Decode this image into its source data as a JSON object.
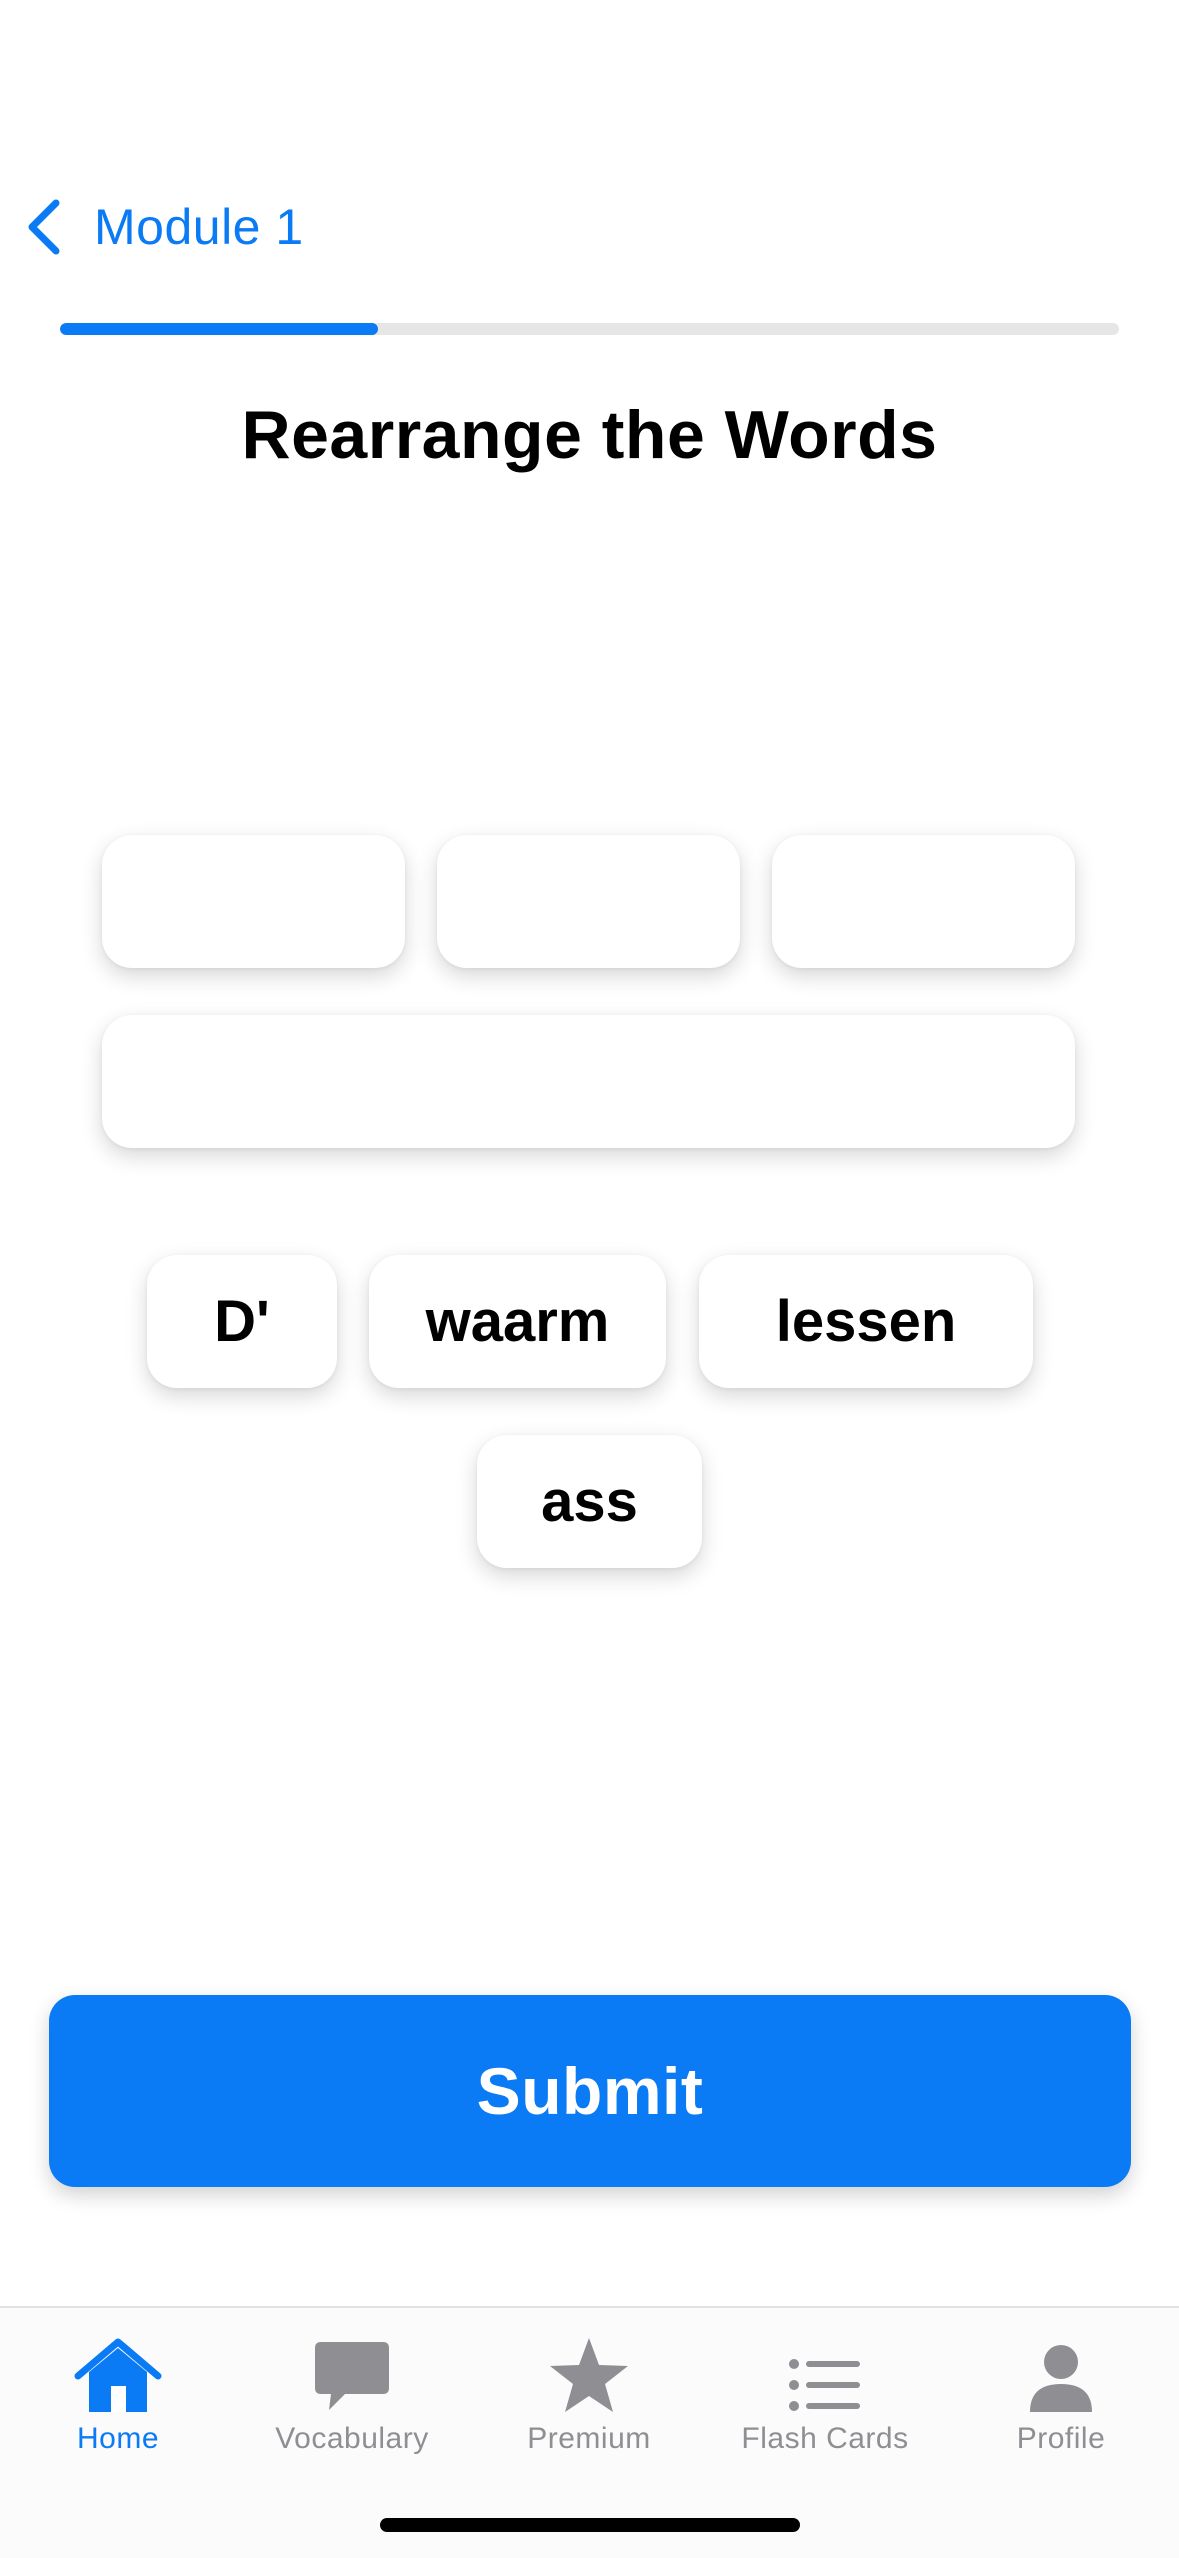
{
  "header": {
    "back_label": "Module 1"
  },
  "progress": {
    "fraction": 0.3
  },
  "exercise": {
    "title": "Rearrange the Words",
    "answer_slots": [
      "",
      "",
      "",
      ""
    ],
    "word_choices": [
      "D'",
      "waarm",
      "lessen",
      "ass"
    ]
  },
  "submit": {
    "label": "Submit"
  },
  "colors": {
    "accent": "#0a7af5",
    "inactive": "#8e8e93"
  },
  "tabbar": {
    "items": [
      {
        "label": "Home",
        "icon": "home-icon",
        "active": true
      },
      {
        "label": "Vocabulary",
        "icon": "chat-bubble-icon",
        "active": false
      },
      {
        "label": "Premium",
        "icon": "star-icon",
        "active": false
      },
      {
        "label": "Flash Cards",
        "icon": "list-icon",
        "active": false
      },
      {
        "label": "Profile",
        "icon": "person-icon",
        "active": false
      }
    ]
  }
}
